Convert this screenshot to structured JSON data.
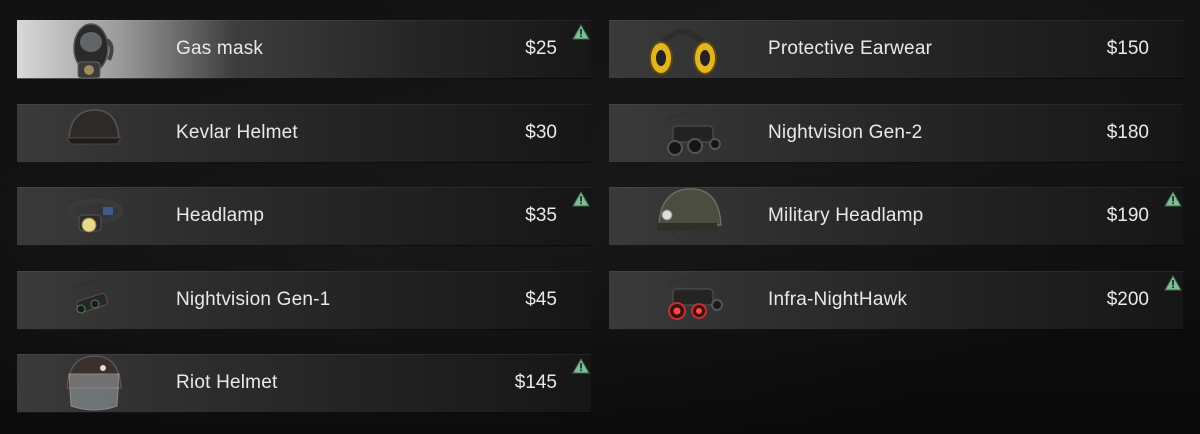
{
  "shop": {
    "left_column": [
      {
        "name": "Gas mask",
        "price": "$25",
        "warning": true,
        "selected": true,
        "icon": "gas-mask-icon"
      },
      {
        "name": "Kevlar Helmet",
        "price": "$30",
        "warning": false,
        "selected": false,
        "icon": "kevlar-helmet-icon"
      },
      {
        "name": "Headlamp",
        "price": "$35",
        "warning": true,
        "selected": false,
        "icon": "headlamp-icon"
      },
      {
        "name": "Nightvision Gen-1",
        "price": "$45",
        "warning": false,
        "selected": false,
        "icon": "nightvision-gen1-icon"
      },
      {
        "name": "Riot Helmet",
        "price": "$145",
        "warning": true,
        "selected": false,
        "icon": "riot-helmet-icon"
      }
    ],
    "right_column": [
      {
        "name": "Protective Earwear",
        "price": "$150",
        "warning": false,
        "selected": false,
        "icon": "earmuffs-icon"
      },
      {
        "name": "Nightvision Gen-2",
        "price": "$180",
        "warning": false,
        "selected": false,
        "icon": "nightvision-gen2-icon"
      },
      {
        "name": "Military Headlamp",
        "price": "$190",
        "warning": true,
        "selected": false,
        "icon": "military-headlamp-icon"
      },
      {
        "name": "Infra-NightHawk",
        "price": "$200",
        "warning": true,
        "selected": false,
        "icon": "infra-nighthawk-icon"
      }
    ]
  },
  "colors": {
    "text": "#e9e9e9",
    "warning_fill": "#7fbf96",
    "row_dark": "#161616"
  }
}
